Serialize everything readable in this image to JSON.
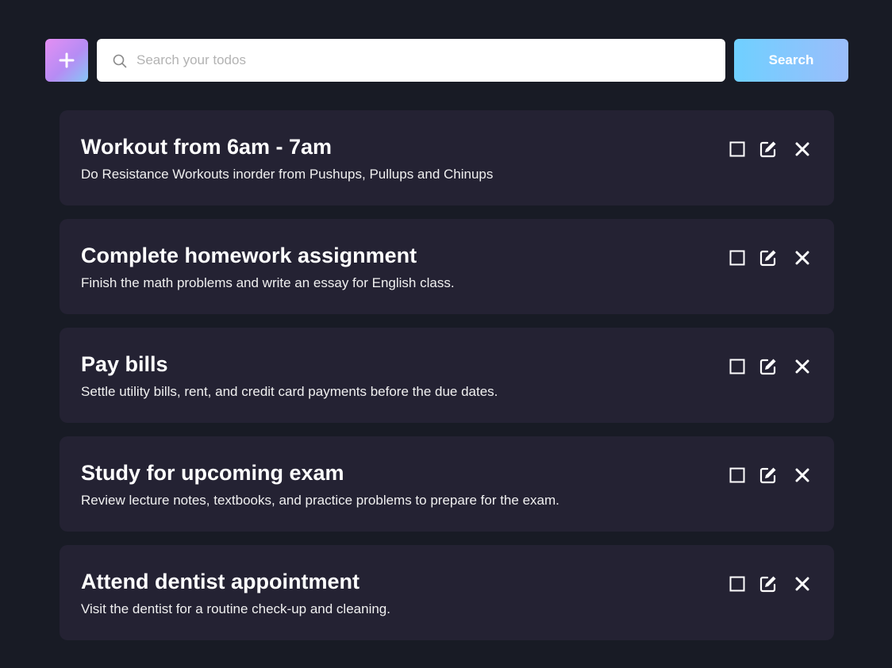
{
  "toolbar": {
    "add_icon": "plus-icon",
    "search_placeholder": "Search your todos",
    "search_value": "",
    "search_icon": "search-icon",
    "search_button_label": "Search"
  },
  "colors": {
    "background": "#181b25",
    "card": "#242233",
    "add_gradient": [
      "#e48ff3",
      "#86c6f7"
    ],
    "search_button_gradient": [
      "#6fd0ff",
      "#9bbdfb"
    ]
  },
  "todos": [
    {
      "title": "Workout from 6am - 7am",
      "description": "Do Resistance Workouts inorder from Pushups, Pullups and Chinups",
      "completed": false,
      "actions": [
        "checkbox-icon",
        "edit-icon",
        "close-icon"
      ]
    },
    {
      "title": "Complete homework assignment",
      "description": "Finish the math problems and write an essay for English class.",
      "completed": false,
      "actions": [
        "checkbox-icon",
        "edit-icon",
        "close-icon"
      ]
    },
    {
      "title": "Pay bills",
      "description": "Settle utility bills, rent, and credit card payments before the due dates.",
      "completed": false,
      "actions": [
        "checkbox-icon",
        "edit-icon",
        "close-icon"
      ]
    },
    {
      "title": "Study for upcoming exam",
      "description": "Review lecture notes, textbooks, and practice problems to prepare for the exam.",
      "completed": false,
      "actions": [
        "checkbox-icon",
        "edit-icon",
        "close-icon"
      ]
    },
    {
      "title": "Attend dentist appointment",
      "description": "Visit the dentist for a routine check-up and cleaning.",
      "completed": false,
      "actions": [
        "checkbox-icon",
        "edit-icon",
        "close-icon"
      ]
    }
  ]
}
